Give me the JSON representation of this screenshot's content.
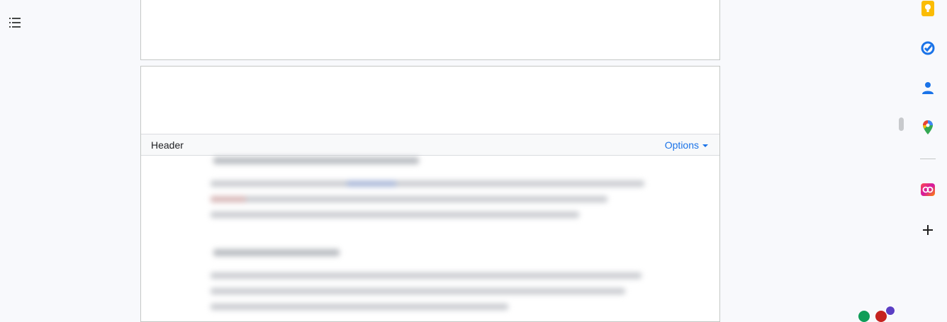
{
  "toolbar": {
    "outline_icon": "list-icon"
  },
  "document": {
    "header_label": "Header",
    "options_label": "Options"
  },
  "side_panel": {
    "icons": [
      "keep-icon",
      "tasks-icon",
      "contacts-icon",
      "maps-icon",
      "creative-cloud-icon",
      "add-icon"
    ]
  },
  "colors": {
    "accent": "#1a73e8",
    "keep": "#fbbc04",
    "tasks": "#1a73e8",
    "contacts": "#1a73e8",
    "background": "#f8f9fc"
  }
}
